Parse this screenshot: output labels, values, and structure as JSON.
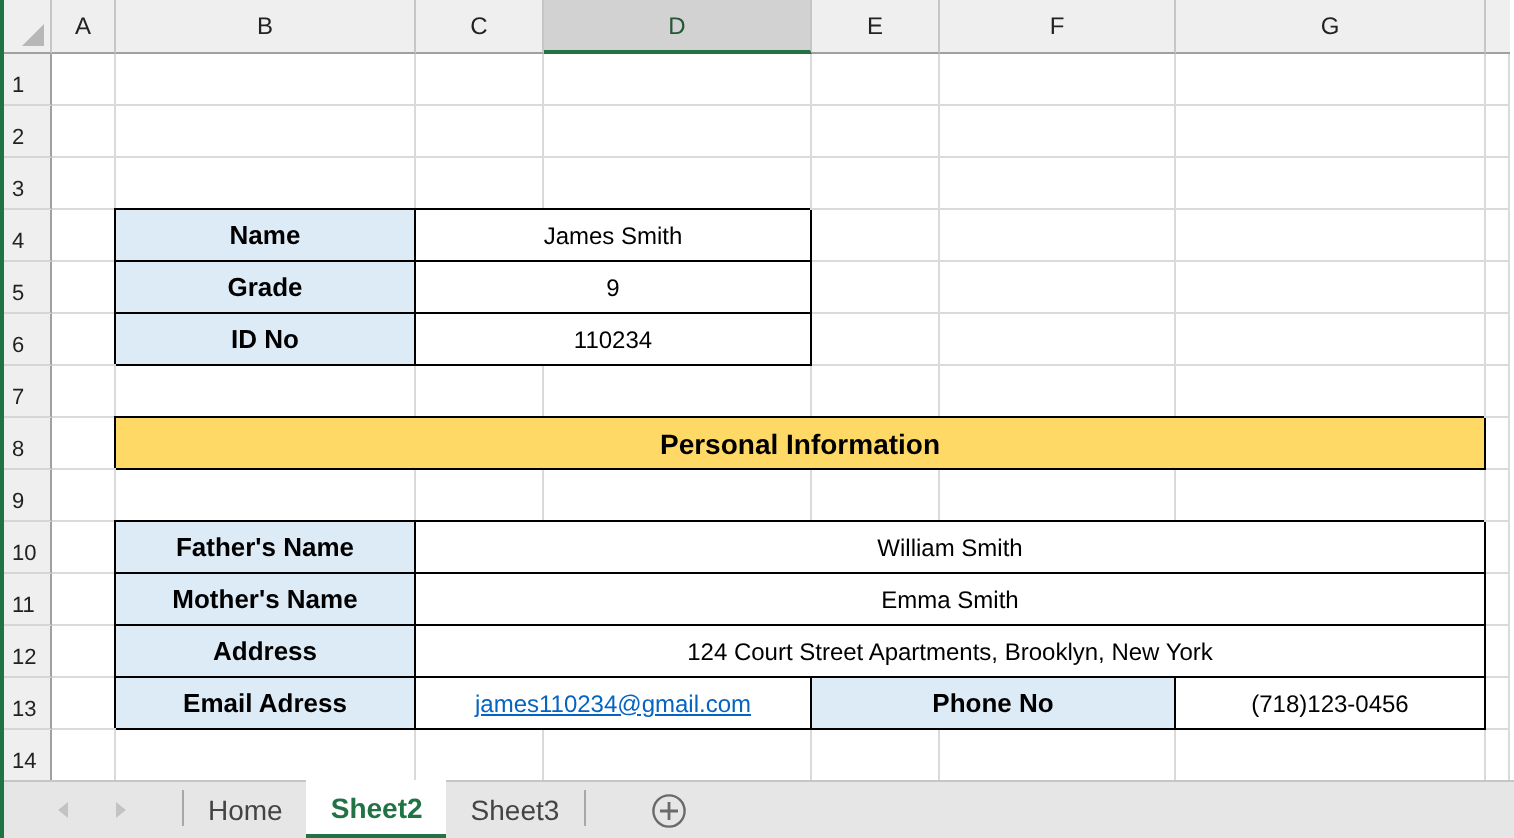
{
  "columns": [
    {
      "label": "A",
      "selected": false
    },
    {
      "label": "B",
      "selected": false
    },
    {
      "label": "C",
      "selected": false
    },
    {
      "label": "D",
      "selected": true
    },
    {
      "label": "E",
      "selected": false
    },
    {
      "label": "F",
      "selected": false
    },
    {
      "label": "G",
      "selected": false
    }
  ],
  "row_numbers": [
    "1",
    "2",
    "3",
    "4",
    "5",
    "6",
    "7",
    "8",
    "9",
    "10",
    "11",
    "12",
    "13",
    "14"
  ],
  "student_table": [
    {
      "label": "Name",
      "value": "James Smith"
    },
    {
      "label": "Grade",
      "value": "9"
    },
    {
      "label": "ID No",
      "value": "110234"
    }
  ],
  "banner": {
    "text": "Personal Information"
  },
  "personal_table": [
    {
      "kind": "single",
      "label": "Father's Name",
      "value": "William Smith"
    },
    {
      "kind": "single",
      "label": "Mother's Name",
      "value": "Emma Smith"
    },
    {
      "kind": "single",
      "label": "Address",
      "value": "124 Court Street Apartments, Brooklyn, New York"
    },
    {
      "kind": "double",
      "label": "Email Adress",
      "value": "james110234@gmail.com",
      "label_2": "Phone No",
      "value_2": "(718)123-0456"
    }
  ],
  "sheet_tabs": [
    {
      "label": "Home",
      "selected": false
    },
    {
      "label": "Sheet2",
      "selected": true
    },
    {
      "label": "Sheet3",
      "selected": false
    }
  ]
}
